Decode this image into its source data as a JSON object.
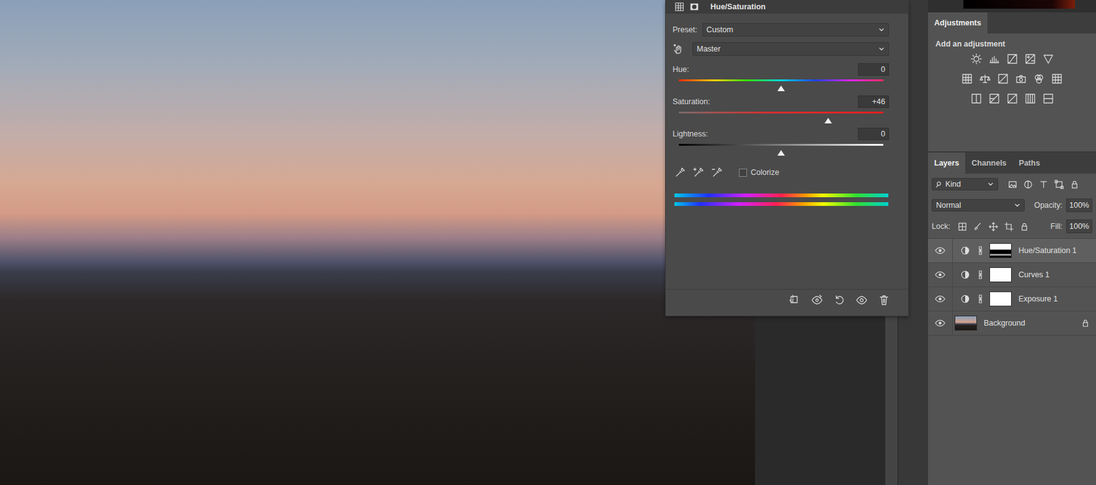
{
  "properties": {
    "title": "Hue/Saturation",
    "preset_label": "Preset:",
    "preset": "Custom",
    "channel": "Master",
    "sliders": [
      {
        "label": "Hue:",
        "value": "0",
        "level": 0.5,
        "kind": "hue"
      },
      {
        "label": "Saturation:",
        "value": "+46",
        "level": 0.73,
        "kind": "saturation"
      },
      {
        "label": "Lightness:",
        "value": "0",
        "level": 0.5,
        "kind": "lightness"
      }
    ],
    "colorize": {
      "label": "Colorize",
      "checked": false
    }
  },
  "adjustments": {
    "title": "Adjustments",
    "subtitle": "Add an adjustment"
  },
  "layers_panel": {
    "tabs": [
      {
        "label": "Layers",
        "selected": true
      },
      {
        "label": "Channels",
        "selected": false
      },
      {
        "label": "Paths",
        "selected": false
      }
    ],
    "filter": "Kind",
    "blend_mode": "Normal",
    "opacity_label": "Opacity:",
    "opacity": "100%",
    "lock_label": "Lock:",
    "fill_label": "Fill:",
    "fill": "100%",
    "layers": [
      {
        "name": "Hue/Saturation 1",
        "kind": "adjustment",
        "mask": "mixed",
        "selected": true,
        "visible": true,
        "locked": false
      },
      {
        "name": "Curves 1",
        "kind": "adjustment",
        "mask": "white",
        "selected": false,
        "visible": true,
        "locked": false
      },
      {
        "name": "Exposure 1",
        "kind": "adjustment",
        "mask": "white",
        "selected": false,
        "visible": true,
        "locked": false
      },
      {
        "name": "Background",
        "kind": "image",
        "mask": "none",
        "selected": false,
        "visible": true,
        "locked": true
      }
    ]
  }
}
